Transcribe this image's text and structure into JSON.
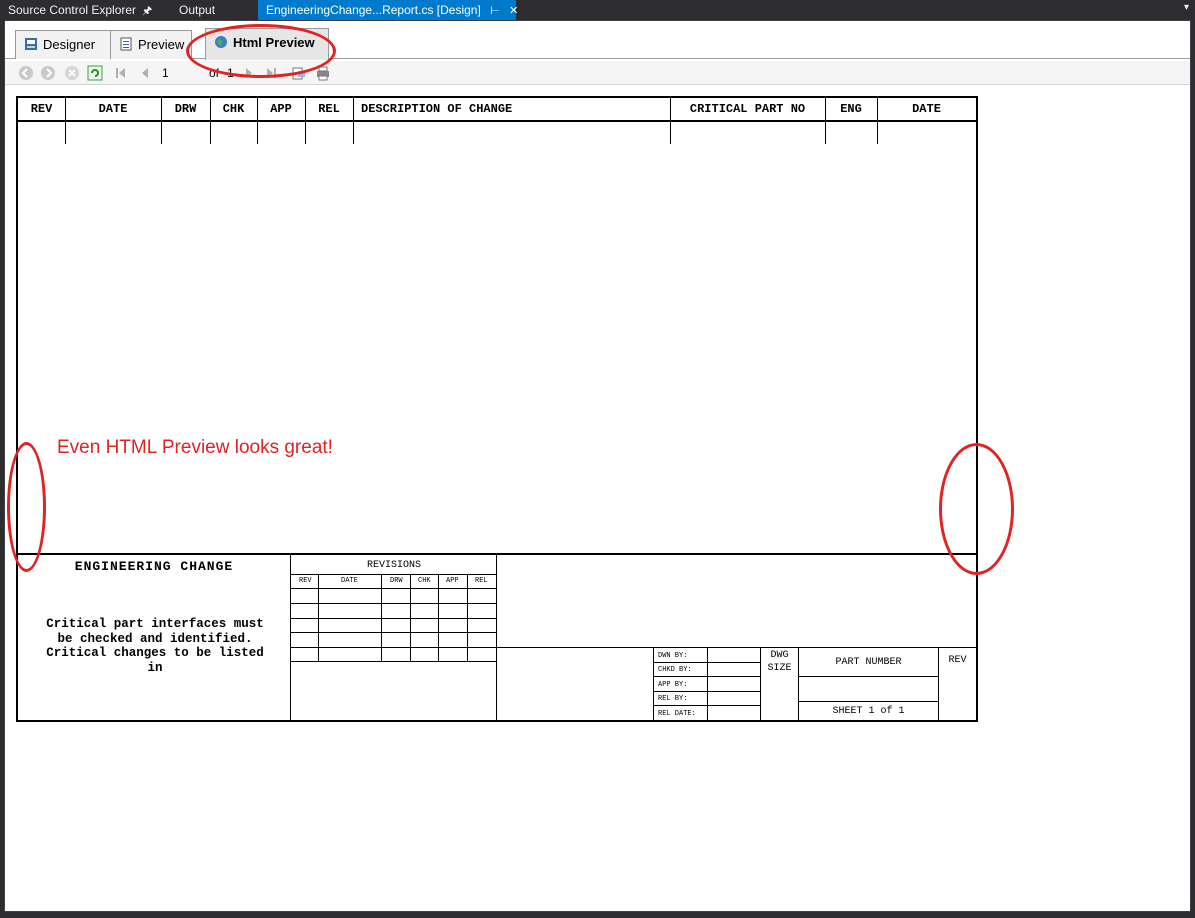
{
  "tabs": {
    "source_control": "Source Control Explorer",
    "output": "Output",
    "active_doc": "EngineeringChange...Report.cs [Design]"
  },
  "view_tabs": [
    "Designer",
    "Preview",
    "Html Preview"
  ],
  "toolbar": {
    "page": "1",
    "of_label": "of",
    "total": "1"
  },
  "revisions_header": [
    "REV",
    "DATE",
    "DRW",
    "CHK",
    "APP",
    "REL",
    "DESCRIPTION OF CHANGE",
    "CRITICAL PART NO",
    "ENG",
    "DATE"
  ],
  "annotation": "Even HTML Preview looks great!",
  "title_block": {
    "title": "ENGINEERING CHANGE",
    "note": "Critical part interfaces must be checked and identified. Critical changes to be listed in",
    "revisions_title": "REVISIONS",
    "revisions_cols": [
      "REV",
      "DATE",
      "DRW",
      "CHK",
      "APP",
      "REL"
    ],
    "labels": [
      "DWN BY:",
      "CHKD BY:",
      "APP BY:",
      "REL BY:",
      "REL DATE:"
    ],
    "dwg_size_1": "DWG",
    "dwg_size_2": "SIZE",
    "part_number": "PART NUMBER",
    "rev": "REV",
    "sheet": "SHEET 1 of 1"
  },
  "colors": {
    "accent": "#007acc",
    "annotation": "#e02424",
    "chrome": "#2d2d30"
  }
}
